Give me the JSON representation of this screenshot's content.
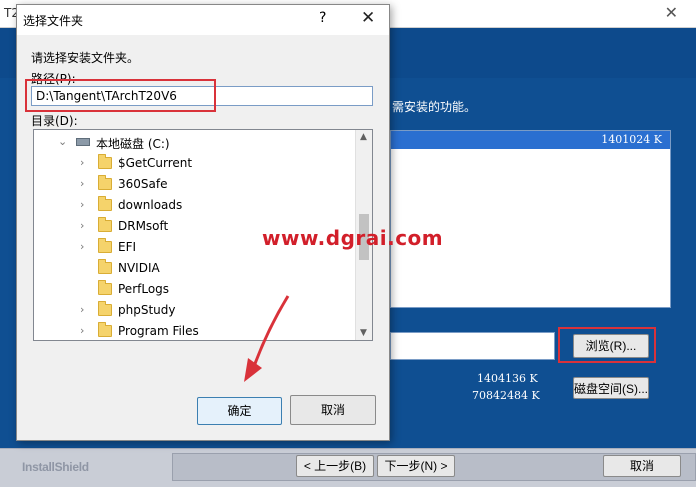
{
  "installer": {
    "title": "T2",
    "description": "需安装的功能。",
    "feature_size": "1401024 K",
    "browse_label": "浏览(R)...",
    "disk_space_label": "磁盘空间(S)...",
    "size_required": "1404136 K",
    "size_available": "70842484 K",
    "brand": "InstallShield",
    "back_label": "< 上一步(B)",
    "next_label": "下一步(N) >",
    "cancel_label": "取消"
  },
  "dialog": {
    "title": "选择文件夹",
    "help": "?",
    "close": "✕",
    "prompt": "请选择安装文件夹。",
    "path_label": "路径(P):",
    "path_value": "D:\\Tangent\\TArchT20V6",
    "dir_label": "目录(D):",
    "tree": {
      "root": "本地磁盘 (C:)",
      "folders": [
        {
          "name": "$GetCurrent",
          "expandable": true
        },
        {
          "name": "360Safe",
          "expandable": true
        },
        {
          "name": "downloads",
          "expandable": true
        },
        {
          "name": "DRMsoft",
          "expandable": true
        },
        {
          "name": "EFI",
          "expandable": true
        },
        {
          "name": "NVIDIA",
          "expandable": false
        },
        {
          "name": "PerfLogs",
          "expandable": false
        },
        {
          "name": "phpStudy",
          "expandable": true
        },
        {
          "name": "Program Files",
          "expandable": true
        }
      ]
    },
    "ok_label": "确定",
    "cancel_label": "取消"
  },
  "watermark": "www.dgrai.com",
  "colors": {
    "highlight": "#d9323a",
    "installer_blue": "#0f4f92",
    "selection": "#2a6fd0"
  }
}
